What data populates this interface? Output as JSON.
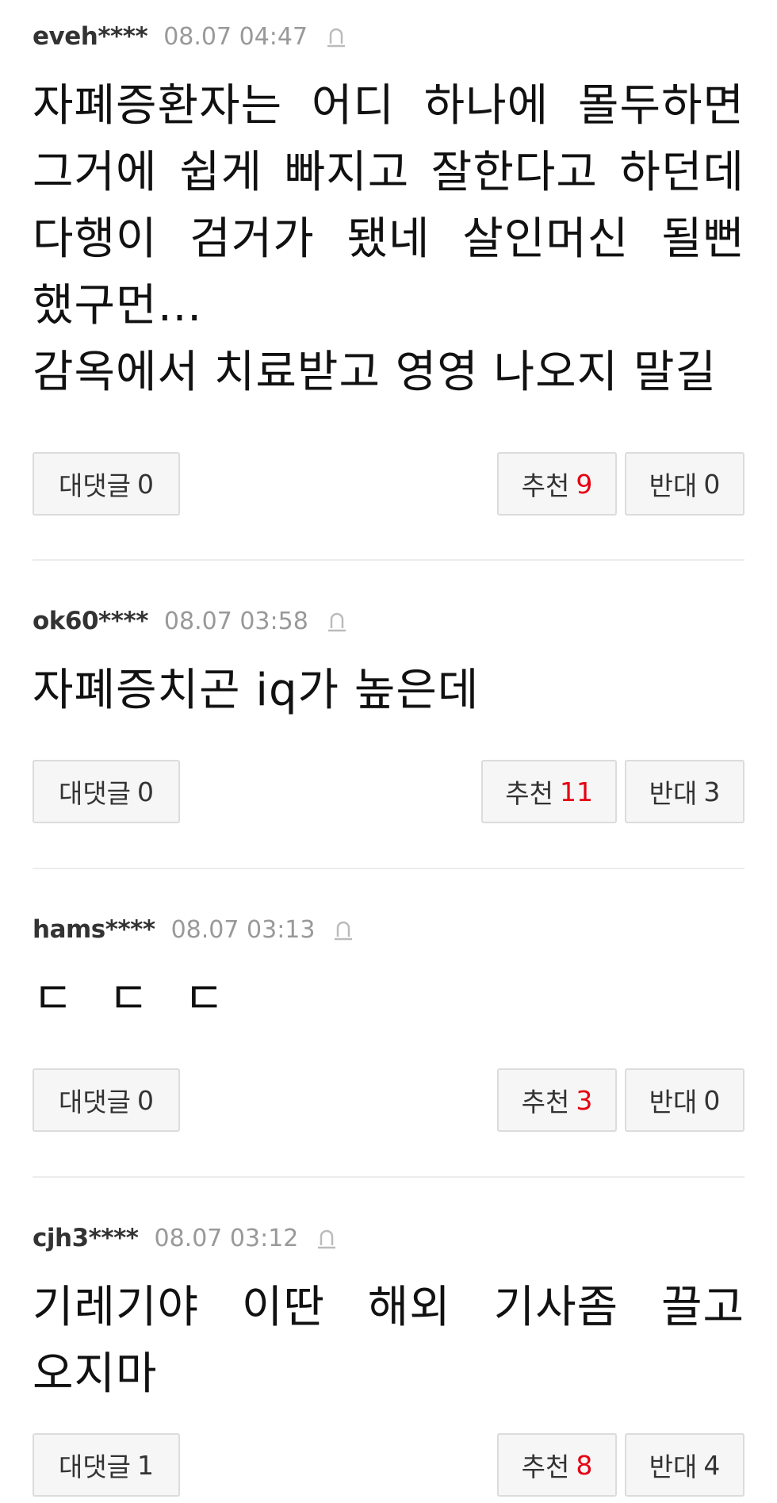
{
  "comments": [
    {
      "author": "eveh****",
      "time": "08.07 04:47",
      "lines": [
        "자폐증환자는 어디 하나에 몰두하면 그거에 쉽게 빠지고 잘한다고 하던데 다행이 검거가 됐네 살인머신 될뻔 했구먼…",
        "감옥에서 치료받고 영영 나오지 말길"
      ],
      "reply_label": "대댓글",
      "reply_count": "0",
      "like_label": "추천",
      "like_count": "9",
      "dislike_label": "반대",
      "dislike_count": "0"
    },
    {
      "author": "ok60****",
      "time": "08.07 03:58",
      "lines": [
        "자폐증치곤 iq가 높은데"
      ],
      "reply_label": "대댓글",
      "reply_count": "0",
      "like_label": "추천",
      "like_count": "11",
      "dislike_label": "반대",
      "dislike_count": "3"
    },
    {
      "author": "hams****",
      "time": "08.07 03:13",
      "lines": [
        "ㄷ ㄷ ㄷ"
      ],
      "reply_label": "대댓글",
      "reply_count": "0",
      "like_label": "추천",
      "like_count": "3",
      "dislike_label": "반대",
      "dislike_count": "0"
    },
    {
      "author": "cjh3****",
      "time": "08.07 03:12",
      "lines": [
        "기레기야 이딴 해외 기사좀 끌고 오지마"
      ],
      "reply_label": "대댓글",
      "reply_count": "1",
      "like_label": "추천",
      "like_count": "8",
      "dislike_label": "반대",
      "dislike_count": "4"
    }
  ],
  "colors": {
    "accent_red": "#e60012",
    "meta_gray": "#999999",
    "border": "#dcdcdc"
  },
  "icons": {
    "report": "siren-icon"
  }
}
